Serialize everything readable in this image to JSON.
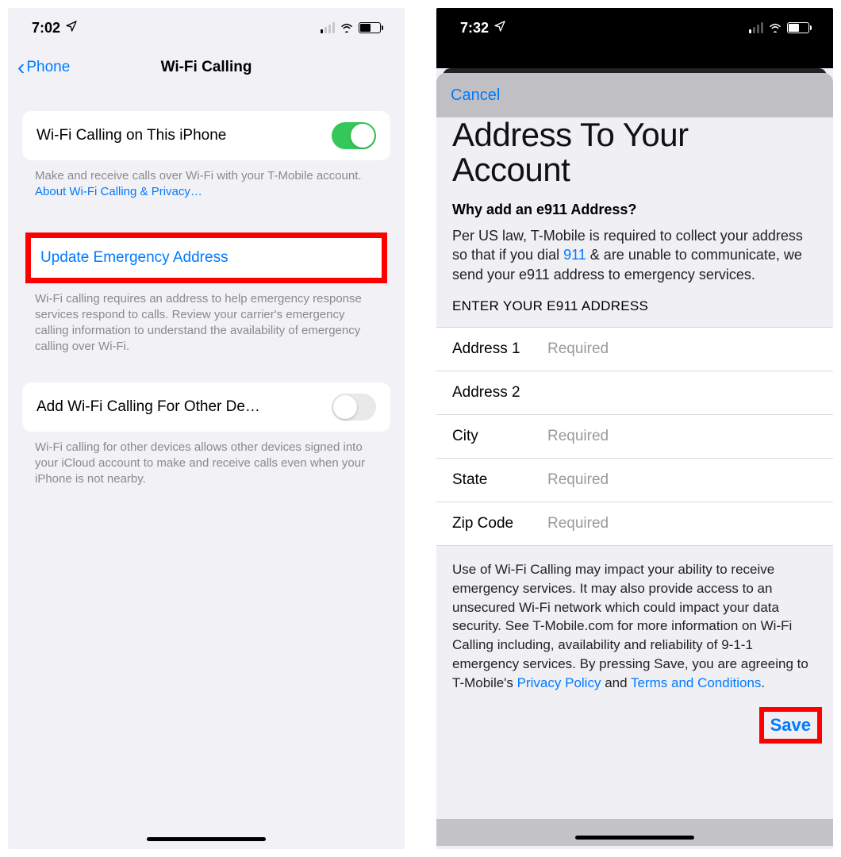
{
  "left": {
    "status": {
      "time": "7:02"
    },
    "nav": {
      "back": "Phone",
      "title": "Wi-Fi Calling"
    },
    "row1": {
      "label": "Wi-Fi Calling on This iPhone"
    },
    "footer1a": "Make and receive calls over Wi-Fi with your T-Mobile account. ",
    "footer1b_link": "About Wi-Fi Calling & Privacy…",
    "row2": {
      "label": "Update Emergency Address"
    },
    "footer2": "Wi-Fi calling requires an address to help emergency response services respond to calls. Review your carrier's emergency calling information to understand the availability of emergency calling over Wi-Fi.",
    "row3": {
      "label": "Add Wi-Fi Calling For Other De…"
    },
    "footer3": "Wi-Fi calling for other devices allows other devices signed into your iCloud account to make and receive calls even when your iPhone is not nearby."
  },
  "right": {
    "status": {
      "time": "7:32"
    },
    "cancel": "Cancel",
    "title_line1": "Address To Your",
    "title_line2": "Account",
    "why_heading": "Why add an e911 Address?",
    "para1_a": "Per US law, T-Mobile is required to collect your address so that if you dial ",
    "para1_link": "911",
    "para1_b": " & are unable to communicate, we send your e911 address to emergency services.",
    "enter_label": "ENTER YOUR E911 ADDRESS",
    "fields": {
      "addr1": {
        "label": "Address 1",
        "placeholder": "Required"
      },
      "addr2": {
        "label": "Address 2",
        "placeholder": ""
      },
      "city": {
        "label": "City",
        "placeholder": "Required"
      },
      "state": {
        "label": "State",
        "placeholder": "Required"
      },
      "zip": {
        "label": "Zip Code",
        "placeholder": "Required"
      }
    },
    "footer_a": "Use of Wi-Fi Calling may impact your ability to receive emergency services. It may also provide access to an unsecured Wi-Fi network which could impact your data security. See T-Mobile.com for more information on Wi-Fi Calling including, availability and reliability of 9-1-1 emergency services. By pressing Save, you are agreeing to T-Mobile's ",
    "footer_link1": "Privacy Policy",
    "footer_mid": " and ",
    "footer_link2": "Terms and Conditions",
    "footer_end": ".",
    "save": "Save"
  }
}
